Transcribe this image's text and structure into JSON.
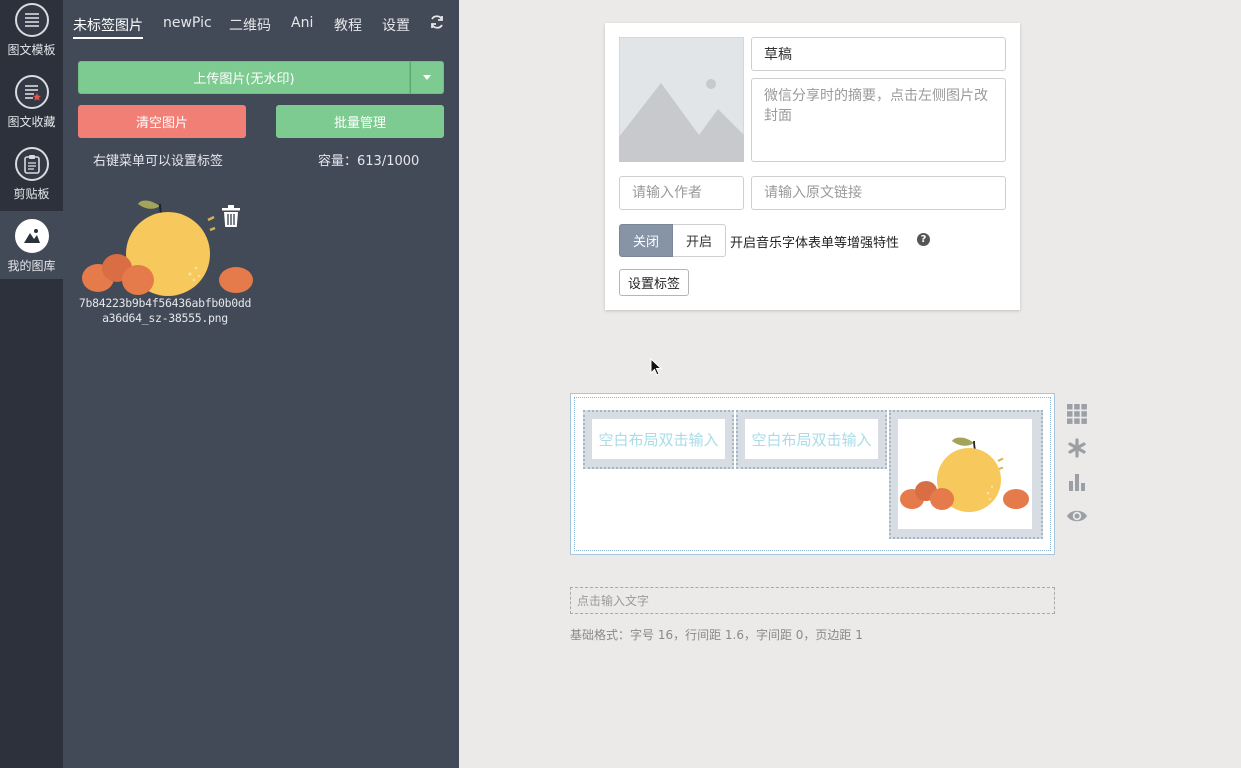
{
  "sidebar": {
    "items": [
      {
        "label": "图文模板",
        "icon": "template-list-icon",
        "active": false
      },
      {
        "label": "图文收藏",
        "icon": "favorites-icon",
        "active": false
      },
      {
        "label": "剪贴板",
        "icon": "clipboard-icon",
        "active": false
      },
      {
        "label": "我的图库",
        "icon": "gallery-icon",
        "active": true
      }
    ]
  },
  "gallery": {
    "tabs": [
      "未标签图片",
      "newPic",
      "二维码",
      "Ani",
      "教程",
      "设置"
    ],
    "active_tab": "未标签图片",
    "upload_label": "上传图片(无水印)",
    "clear_label": "清空图片",
    "batch_label": "批量管理",
    "hint": "右键菜单可以设置标签",
    "capacity": "容量：613/1000",
    "images": [
      {
        "filename": "7b84223b9b4f56436abfb0b0dda36d64_sz-38555.png"
      }
    ]
  },
  "article": {
    "title_value": "草稿",
    "digest_placeholder": "微信分享时的摘要，点击左侧图片改封面",
    "author_placeholder": "请输入作者",
    "source_placeholder": "请输入原文链接",
    "toggle_off": "关闭",
    "toggle_on": "开启",
    "toggle_label": "开启音乐字体表单等增强特性",
    "help_symbol": "?",
    "tag_button": "设置标签"
  },
  "editor": {
    "cell_placeholder_1": "空白布局双击输入",
    "cell_placeholder_2": "空白布局双击输入",
    "text_placeholder": "点击输入文字",
    "format_info": "基础格式：字号 16，行间距 1.6，字间距 0，页边距 1"
  },
  "colors": {
    "rail_bg": "#2c313b",
    "panel_bg": "#434a57",
    "green": "#7ecb91",
    "red": "#f27f76",
    "toggle_active": "#8794a6",
    "canvas_bg": "#ebeae8"
  }
}
